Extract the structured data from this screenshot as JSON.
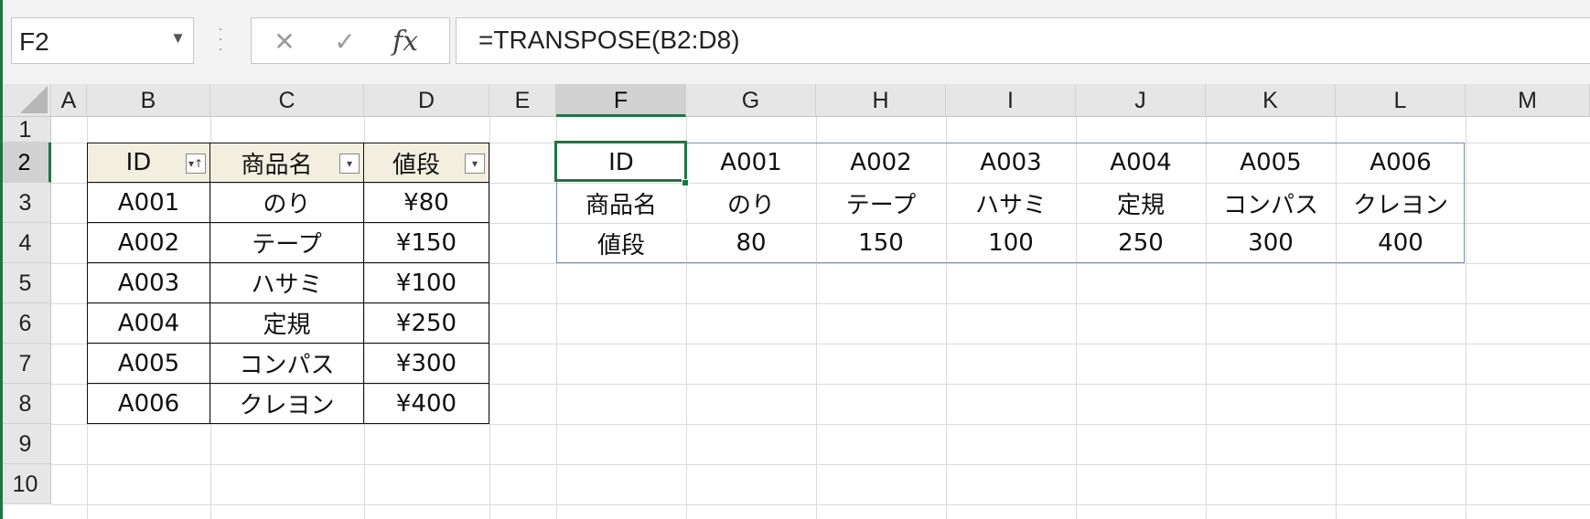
{
  "namebox": {
    "value": "F2",
    "arrow": "▼"
  },
  "formula": {
    "value": "=TRANSPOSE(B2:D8)",
    "fx_label": "fx",
    "cancel_icon": "✕",
    "enter_icon": "✓"
  },
  "columns": [
    "A",
    "B",
    "C",
    "D",
    "E",
    "F",
    "G",
    "H",
    "I",
    "J",
    "K",
    "L",
    "M"
  ],
  "rows": [
    "1",
    "2",
    "3",
    "4",
    "5",
    "6",
    "7",
    "8",
    "9",
    "10"
  ],
  "selected": {
    "column": "F",
    "row": "2"
  },
  "source_table": {
    "headers": [
      "ID",
      "商品名",
      "値段"
    ],
    "rows": [
      [
        "A001",
        "のり",
        "¥80"
      ],
      [
        "A002",
        "テープ",
        "¥150"
      ],
      [
        "A003",
        "ハサミ",
        "¥100"
      ],
      [
        "A004",
        "定規",
        "¥250"
      ],
      [
        "A005",
        "コンパス",
        "¥300"
      ],
      [
        "A006",
        "クレヨン",
        "¥400"
      ]
    ]
  },
  "transposed": [
    [
      "ID",
      "A001",
      "A002",
      "A003",
      "A004",
      "A005",
      "A006"
    ],
    [
      "商品名",
      "のり",
      "テープ",
      "ハサミ",
      "定規",
      "コンパス",
      "クレヨン"
    ],
    [
      "値段",
      "80",
      "150",
      "100",
      "250",
      "300",
      "400"
    ]
  ],
  "colors": {
    "accent": "#217346",
    "header_fill": "#f2efe0",
    "range_border": "#7f8ea3"
  }
}
